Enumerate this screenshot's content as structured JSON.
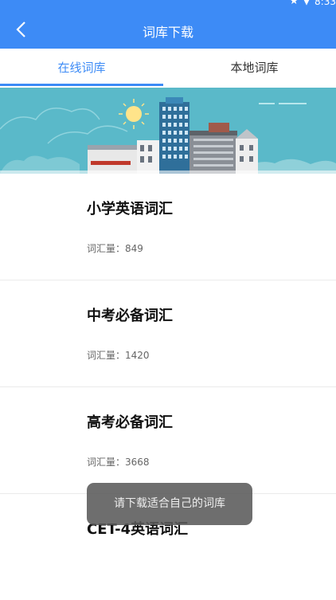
{
  "status_bar": {
    "time": "8:33",
    "icons": [
      "star-icon",
      "wifi-icon"
    ]
  },
  "header": {
    "title": "词库下载",
    "back_icon": "chevron-left-icon"
  },
  "tabs": [
    {
      "label": "在线词库",
      "active": true
    },
    {
      "label": "本地词库",
      "active": false
    }
  ],
  "colors": {
    "accent": "#3d8bf6",
    "banner_bg": "#5ab9c9"
  },
  "vocab_list": [
    {
      "name": "小学英语词汇",
      "count_label": "词汇量：849"
    },
    {
      "name": "中考必备词汇",
      "count_label": "词汇量：1420"
    },
    {
      "name": "高考必备词汇",
      "count_label": "词汇量：3668"
    },
    {
      "name": "CET-4英语词汇",
      "count_label": ""
    }
  ],
  "toast": {
    "message": "请下载适合自己的词库"
  }
}
